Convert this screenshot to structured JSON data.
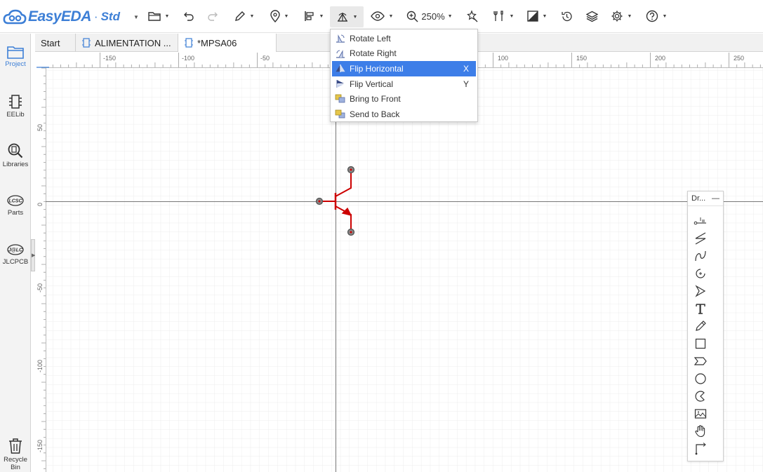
{
  "app": {
    "logo_text": "EasyEDA",
    "logo_sep": "·",
    "logo_edition": "Std",
    "zoom_label": "250%"
  },
  "sidebar": {
    "items": [
      {
        "label": "Project",
        "icon": "project-icon"
      },
      {
        "label": "EELib",
        "icon": "chip-icon"
      },
      {
        "label": "Libraries",
        "icon": "library-search-icon"
      },
      {
        "label": "Parts",
        "icon": "lcsc-icon"
      },
      {
        "label": "JLCPCB",
        "icon": "jlc-icon"
      },
      {
        "label": "Recycle Bin",
        "icon": "trash-icon"
      }
    ]
  },
  "tabs": [
    {
      "label": "Start"
    },
    {
      "label": "ALIMENTATION ..."
    },
    {
      "label": "*MPSA06"
    }
  ],
  "rotate_menu": {
    "items": [
      {
        "label": "Rotate Left",
        "shortcut": ""
      },
      {
        "label": "Rotate Right",
        "shortcut": ""
      },
      {
        "label": "Flip Horizontal",
        "shortcut": "X"
      },
      {
        "label": "Flip Vertical",
        "shortcut": "Y"
      },
      {
        "label": "Bring to Front",
        "shortcut": ""
      },
      {
        "label": "Send to Back",
        "shortcut": ""
      }
    ]
  },
  "ruler": {
    "top_labels": [
      "-150",
      "-100",
      "-50",
      "100",
      "150",
      "200",
      "250"
    ],
    "left_labels": [
      "50",
      "0",
      "-50",
      "-100",
      "-150"
    ]
  },
  "drawing_tools": {
    "title": "Dr...",
    "minimize": "—"
  },
  "colors": {
    "brand": "#3d7fd6",
    "highlight": "#3d7ee8",
    "symbol": "#cc0000"
  }
}
